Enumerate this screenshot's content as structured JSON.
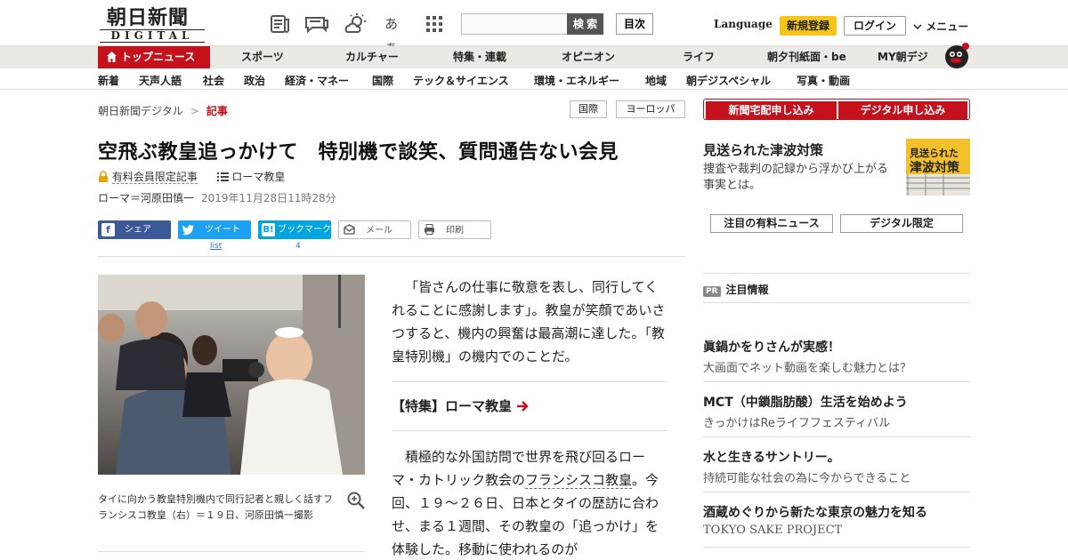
{
  "header": {
    "logo_jp": "朝日新聞",
    "logo_en": "DIGITAL",
    "icons": [
      "newspaper-icon",
      "chat-icon",
      "weather-icon",
      "font-size-icon",
      "grid-icon"
    ],
    "font_icon_text": "あぁ",
    "search_button": "検 索",
    "mokuji": "目次",
    "language": "Language",
    "register": "新規登録",
    "login": "ログイン",
    "menu": "メニュー"
  },
  "nav_main": [
    "トップニュース",
    "スポーツ",
    "カルチャー",
    "特集・連載",
    "オピニオン",
    "ライフ",
    "朝夕刊紙面・be",
    "MY朝デジ"
  ],
  "nav_sub": [
    "新着",
    "天声人語",
    "社会",
    "政治",
    "経済・マネー",
    "国際",
    "テック＆サイエンス",
    "環境・エネルギー",
    "地域",
    "朝デジスペシャル",
    "写真・動画"
  ],
  "breadcrumb": {
    "home": "朝日新聞デジタル",
    "sep": ">",
    "current": "記事"
  },
  "tags": [
    "国際",
    "ヨーロッパ"
  ],
  "article": {
    "title": "空飛ぶ教皇追っかけて　特別機で談笑、質問通告ない会見",
    "members_only": "有料会員限定記事",
    "series": "ローマ教皇",
    "byline": "ローマ＝河原田慎一",
    "datetime": "2019年11月28日11時28分",
    "share": {
      "facebook": "シェア",
      "twitter": "ツイート",
      "twitter_count": "list",
      "hatena": "ブックマーク",
      "hatena_count": "4",
      "mail": "メール",
      "print": "印刷"
    },
    "caption": "タイに向かう教皇特別機内で同行記者と親しく話すフランシスコ教皇（右）＝１９日、河原田慎一撮影",
    "para1": "「皆さんの仕事に敬意を表し、同行してくれることに感謝します」。教皇が笑顔であいさつすると、機内の興奮は最高潮に達した。「教皇特別機」の機内でのことだ。",
    "tokushu": "【特集】ローマ教皇",
    "para2a": "積極的な外国訪問で世界を飛び回るローマ・カトリック教会の",
    "para2link": "フランシスコ教皇",
    "para2b": "。今回、１９～２６日、日本とタイの歴訪に合わせ、まる１週間、その教皇の「追っかけ」を体験した。移動に使われるのが"
  },
  "sidebar": {
    "btn_paper": "新聞宅配申し込み",
    "btn_digital": "デジタル申し込み",
    "feature_title": "見送られた津波対策",
    "feature_desc": "捜査や裁判の記録から浮かび上がる事実とは。",
    "feature_img_l1": "見送られた",
    "feature_img_l2": "津波対策",
    "tab1": "注目の有料ニュース",
    "tab2": "デジタル限定",
    "pr_badge": "PR",
    "pr_label": "注目情報",
    "ads": [
      {
        "title": "眞鍋かをりさんが実感！",
        "desc": "大画面でネット動画を楽しむ魅力とは？"
      },
      {
        "title": "MCT（中鎖脂肪酸）生活を始めよう",
        "desc": "きっかけはReライフフェスティバル"
      },
      {
        "title": "水と生きるサントリー。",
        "desc": "持続可能な社会の為に今からできること"
      },
      {
        "title": "酒蔵めぐりから新たな東京の魅力を知る",
        "desc": "TOKYO SAKE PROJECT"
      }
    ]
  },
  "colors": {
    "brand_red": "#c4111c",
    "nav_bg": "#eae9e4",
    "register_yellow": "#f5c518"
  }
}
